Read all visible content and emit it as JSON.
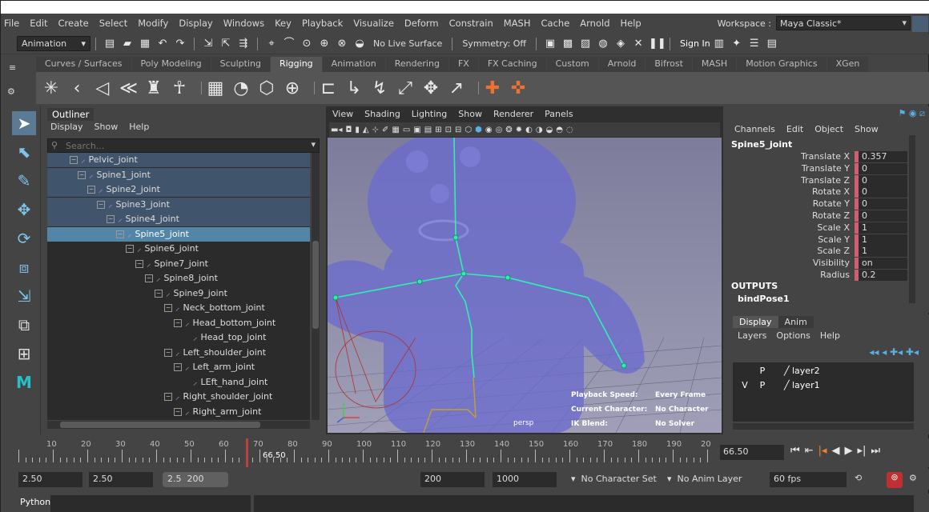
{
  "menubar": {
    "items": [
      "File",
      "Edit",
      "Create",
      "Select",
      "Modify",
      "Display",
      "Windows",
      "Key",
      "Playback",
      "Visualize",
      "Deform",
      "Constrain",
      "MASH",
      "Cache",
      "Arnold",
      "Help"
    ],
    "workspace_label": "Workspace :",
    "workspace_value": "Maya Classic*"
  },
  "statusline": {
    "mode": "Animation",
    "live_surface": "No Live Surface",
    "symmetry": "Symmetry: Off",
    "sign_in": "Sign In"
  },
  "shelf": {
    "tabs": [
      "Curves / Surfaces",
      "Poly Modeling",
      "Sculpting",
      "Rigging",
      "Animation",
      "Rendering",
      "FX",
      "FX Caching",
      "Custom",
      "Arnold",
      "Bifrost",
      "MASH",
      "Motion Graphics",
      "XGen"
    ],
    "active_tab": "Rigging"
  },
  "outliner": {
    "title": "Outliner",
    "menu": [
      "Display",
      "Show",
      "Help"
    ],
    "search_placeholder": "Search...",
    "rows": [
      "Pelvic_joint",
      "Spine1_joint",
      "Spine2_joint",
      "Spine3_joint",
      "Spine4_joint",
      "Spine5_joint",
      "Spine6_joint",
      "Spine7_joint",
      "Spine8_joint",
      "Spine9_joint",
      "Neck_bottom_joint",
      "Head_bottom_joint",
      "Head_top_joint",
      "Left_shoulder_joint",
      "Left_arm_joint",
      "LEft_hand_joint",
      "Right_shoulder_joint",
      "Right_arm_joint"
    ],
    "selected": "Spine5_joint"
  },
  "viewport": {
    "menu": [
      "View",
      "Shading",
      "Lighting",
      "Show",
      "Renderer",
      "Panels"
    ],
    "camera": "persp",
    "hud": {
      "playback_speed_label": "Playback Speed:",
      "playback_speed_value": "Every Frame",
      "current_character_label": "Current Character:",
      "current_character_value": "No Character",
      "ik_blend_label": "IK Blend:",
      "ik_blend_value": "No Solver"
    }
  },
  "channelbox": {
    "menu": [
      "Channels",
      "Edit",
      "Object",
      "Show"
    ],
    "object": "Spine5_joint",
    "attrs": [
      {
        "label": "Translate X",
        "value": "0.357"
      },
      {
        "label": "Translate Y",
        "value": "0"
      },
      {
        "label": "Translate Z",
        "value": "0"
      },
      {
        "label": "Rotate X",
        "value": "0"
      },
      {
        "label": "Rotate Y",
        "value": "0"
      },
      {
        "label": "Rotate Z",
        "value": "0"
      },
      {
        "label": "Scale X",
        "value": "1"
      },
      {
        "label": "Scale Y",
        "value": "1"
      },
      {
        "label": "Scale Z",
        "value": "1"
      },
      {
        "label": "Visibility",
        "value": "on"
      },
      {
        "label": "Radius",
        "value": "0.2"
      }
    ],
    "outputs_label": "OUTPUTS",
    "output_node": "bindPose1"
  },
  "layers": {
    "tabs": [
      "Display",
      "Anim"
    ],
    "menu": [
      "Layers",
      "Options",
      "Help"
    ],
    "rows": [
      {
        "v": "",
        "p": "P",
        "name": "layer2"
      },
      {
        "v": "V",
        "p": "P",
        "name": "layer1"
      }
    ]
  },
  "timeline": {
    "ticks": [
      "10",
      "20",
      "30",
      "40",
      "50",
      "60",
      "70",
      "80",
      "90",
      "100",
      "110",
      "120",
      "130",
      "140",
      "150",
      "160",
      "170",
      "180",
      "190",
      "20"
    ],
    "current": "66.50",
    "current_field": "66.50"
  },
  "range": {
    "start_a": "2.50",
    "start_b": "2.50",
    "slider_a": "2.5",
    "slider_b": "200",
    "end_a": "200",
    "end_b": "1000",
    "char_set": "No Character Set",
    "anim_layer": "No Anim Layer",
    "fps": "60 fps"
  },
  "python": {
    "label": "Python"
  }
}
